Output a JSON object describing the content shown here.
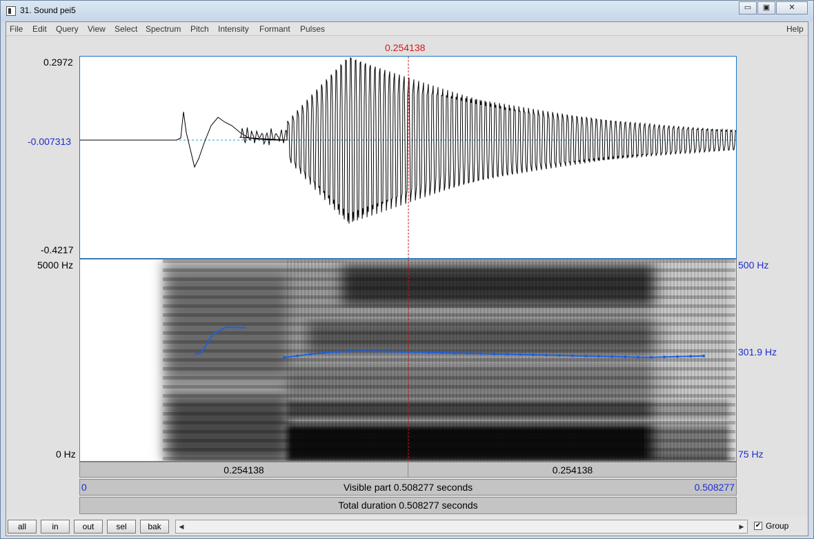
{
  "window": {
    "title": "31. Sound pei5",
    "controls": [
      "▭",
      "▣",
      "✕"
    ]
  },
  "menu": {
    "items": [
      "File",
      "Edit",
      "Query",
      "View",
      "Select",
      "Spectrum",
      "Pitch",
      "Intensity",
      "Formant",
      "Pulses"
    ],
    "help": "Help"
  },
  "cursor": {
    "time": "0.254138"
  },
  "waveform": {
    "y_max": "0.2972",
    "y_center": "-0.007313",
    "y_min": "-0.4217"
  },
  "spectrogram": {
    "freq_top": "5000 Hz",
    "freq_bottom": "0 Hz",
    "pitch_top": "500 Hz",
    "pitch_current": "301.9 Hz",
    "pitch_bottom": "75 Hz"
  },
  "time_bars": {
    "left_segment": "0.254138",
    "right_segment": "0.254138",
    "visible_start": "0",
    "visible_label": "Visible part 0.508277 seconds",
    "visible_end": "0.508277",
    "total_label": "Total duration 0.508277 seconds"
  },
  "toolbar": {
    "buttons": [
      "all",
      "in",
      "out",
      "sel",
      "bak"
    ],
    "group_label": "Group",
    "group_checked": "✔",
    "scroll_left": "◀",
    "scroll_right": "▶"
  },
  "colors": {
    "pitch_line": "#1e5fe0",
    "cursor": "#d21818",
    "mean_line": "#1a9fd8"
  }
}
